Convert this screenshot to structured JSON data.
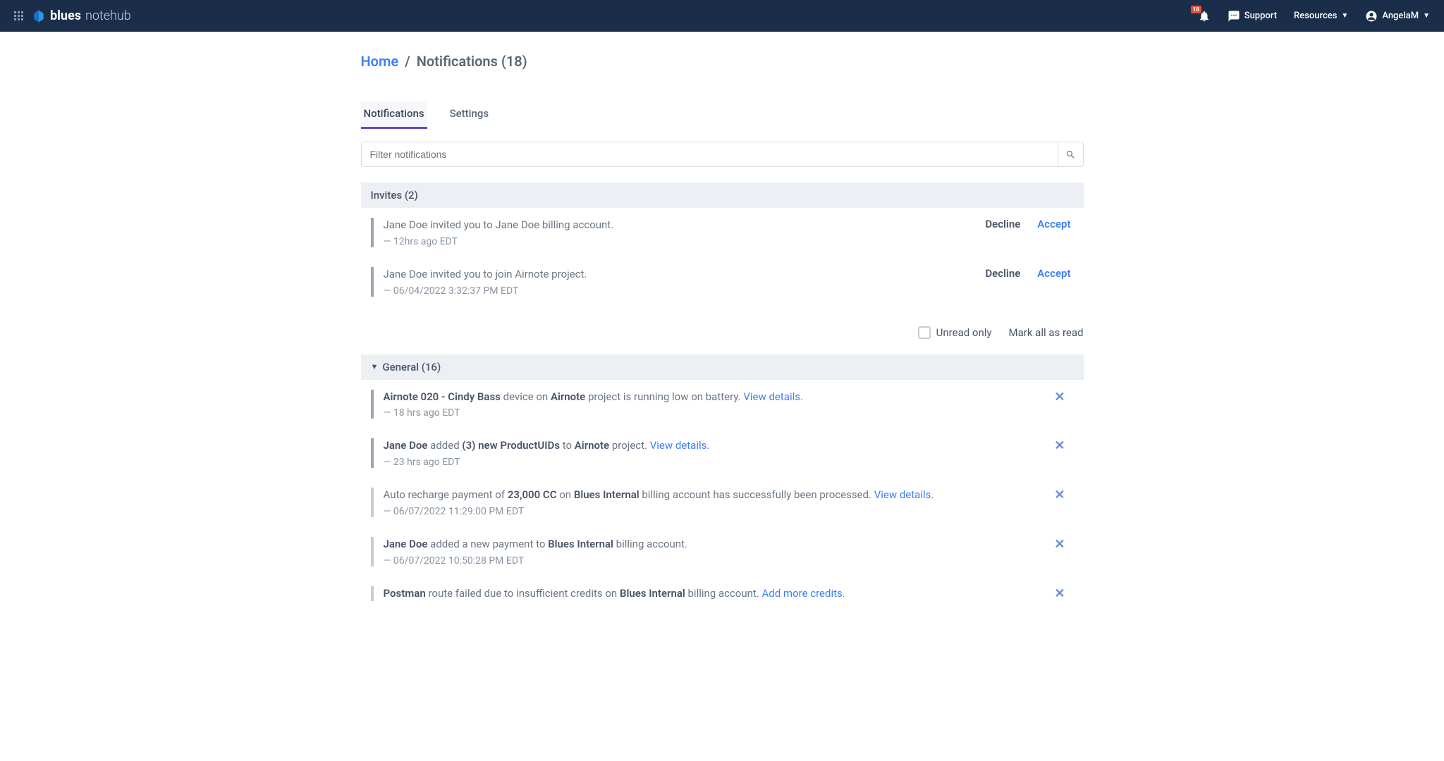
{
  "topbar": {
    "logo_bold": "blues",
    "logo_light": "notehub",
    "badge": "18",
    "support": "Support",
    "resources": "Resources",
    "user": "AngelaM"
  },
  "breadcrumb": {
    "home": "Home",
    "sep": "/",
    "current": "Notifications (18)"
  },
  "tabs": {
    "notifications": "Notifications",
    "settings": "Settings"
  },
  "search": {
    "placeholder": "Filter notifications"
  },
  "invites": {
    "header": "Invites (2)",
    "items": [
      {
        "text": "Jane Doe invited you to Jane Doe billing account.",
        "time": "— 12hrs ago EDT"
      },
      {
        "text": "Jane Doe invited you to join Airnote project.",
        "time": "— 06/04/2022 3:32:37 PM EDT"
      }
    ],
    "decline": "Decline",
    "accept": "Accept"
  },
  "filter": {
    "unread": "Unread only",
    "mark_all": "Mark all as read"
  },
  "general": {
    "header": "General (16)",
    "items": [
      {
        "parts": [
          {
            "t": "b",
            "v": "Airnote 020 - Cindy Bass"
          },
          {
            "t": "n",
            "v": " device on "
          },
          {
            "t": "b",
            "v": "Airnote"
          },
          {
            "t": "n",
            "v": " project is running low on battery. "
          },
          {
            "t": "l",
            "v": "View details"
          },
          {
            "t": "n",
            "v": "."
          }
        ],
        "time": "— 18 hrs ago EDT",
        "unread": true
      },
      {
        "parts": [
          {
            "t": "b",
            "v": "Jane Doe"
          },
          {
            "t": "n",
            "v": " added "
          },
          {
            "t": "b",
            "v": "(3) new ProductUIDs"
          },
          {
            "t": "n",
            "v": " to "
          },
          {
            "t": "b",
            "v": "Airnote"
          },
          {
            "t": "n",
            "v": " project. "
          },
          {
            "t": "l",
            "v": "View details"
          },
          {
            "t": "n",
            "v": "."
          }
        ],
        "time": "— 23 hrs ago EDT",
        "unread": true
      },
      {
        "parts": [
          {
            "t": "n",
            "v": "Auto recharge payment of "
          },
          {
            "t": "b",
            "v": "23,000 CC"
          },
          {
            "t": "n",
            "v": " on "
          },
          {
            "t": "b",
            "v": "Blues Internal"
          },
          {
            "t": "n",
            "v": " billing account has successfully been processed. "
          },
          {
            "t": "l",
            "v": "View details"
          },
          {
            "t": "n",
            "v": "."
          }
        ],
        "time": "— 06/07/2022 11:29:00 PM EDT",
        "unread": false
      },
      {
        "parts": [
          {
            "t": "b",
            "v": "Jane Doe"
          },
          {
            "t": "n",
            "v": " added a new payment to "
          },
          {
            "t": "b",
            "v": "Blues Internal"
          },
          {
            "t": "n",
            "v": " billing account."
          }
        ],
        "time": "— 06/07/2022 10:50:28 PM EDT",
        "unread": false
      },
      {
        "parts": [
          {
            "t": "b",
            "v": "Postman"
          },
          {
            "t": "n",
            "v": " route failed due to insufficient credits on "
          },
          {
            "t": "b",
            "v": "Blues Internal"
          },
          {
            "t": "n",
            "v": " billing account. "
          },
          {
            "t": "l",
            "v": "Add more credits"
          },
          {
            "t": "n",
            "v": "."
          }
        ],
        "time": "",
        "unread": false
      }
    ]
  }
}
